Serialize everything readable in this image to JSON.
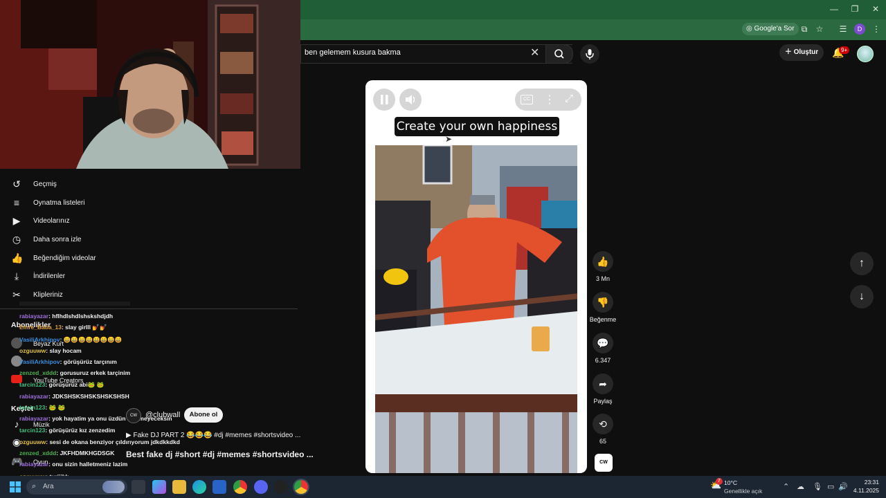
{
  "search": {
    "query": "ben gelemem kusura bakma"
  },
  "toolbar": {
    "google_sor": "Google'a Sor",
    "profile_letter": "D"
  },
  "header": {
    "create_label": "Oluştur",
    "notif_count": "9+"
  },
  "sidebar": {
    "items": [
      {
        "label": "Geçmiş",
        "icon": "history-icon"
      },
      {
        "label": "Oynatma listeleri",
        "icon": "playlist-icon"
      },
      {
        "label": "Videolarınız",
        "icon": "your-videos-icon"
      },
      {
        "label": "Daha sonra izle",
        "icon": "watch-later-icon"
      },
      {
        "label": "Beğendiğim videolar",
        "icon": "like-icon"
      },
      {
        "label": "İndirilenler",
        "icon": "download-icon"
      },
      {
        "label": "Klipleriniz",
        "icon": "scissors-icon"
      }
    ],
    "subscriptions_heading": "Abonelikler",
    "subscriptions": [
      "Beyaz Kurt",
      "YouTube Creators"
    ],
    "explore_heading": "Keşfet",
    "explore": [
      "Müzik",
      "Oyun"
    ]
  },
  "chat": [
    {
      "user": "Emre_Baba_13",
      "text": ": slay girlll 💅💅",
      "color": "#e0a030"
    },
    {
      "user": "rabiayazar",
      "text": ": hflhdlshdlshskshdjdh",
      "color": "#a070e0"
    },
    {
      "user": "VasiliArkhipov",
      "text": ": 😄😄😄😄😄😄😄😄",
      "color": "#3a8de0"
    },
    {
      "user": "ozguuww",
      "text": ": slay hocam",
      "color": "#e0c040"
    },
    {
      "user": "VasiliArkhipov",
      "text": ": görüşürüz tarçınım",
      "color": "#3a8de0"
    },
    {
      "user": "zenzed_xddd",
      "text": ": gorusuruz erkek tarçinim",
      "color": "#4caf50"
    },
    {
      "user": "tarcin123",
      "text": ": görüşürüz abi🐸 🐸",
      "color": "#40c080"
    },
    {
      "user": "rabiayazar",
      "text": ": JDKSHSKSHSKSHSKSHSH",
      "color": "#a070e0"
    },
    {
      "user": "tarcin123",
      "text": ": 🐸 🐸",
      "color": "#40c080"
    },
    {
      "user": "rabiayazar",
      "text": ": yok hayatim ya onu üzdün eklemeyeceksin",
      "color": "#a070e0"
    },
    {
      "user": "tarcin123",
      "text": ": görüşürüz kız zenzedim",
      "color": "#40c080"
    },
    {
      "user": "ozguuww",
      "text": ": sesi de okana benziyor çıldırıyorum jdkdkkdkd",
      "color": "#e0c040"
    },
    {
      "user": "zenzed_xddd",
      "text": ": JKFHDMKHGDSGK",
      "color": "#4caf50"
    },
    {
      "user": "rabiayazar",
      "text": ": onu sizin halletmeniz lazim",
      "color": "#a070e0"
    },
    {
      "user": "ozguuww",
      "text": ": turiiikk",
      "color": "#e0c040"
    }
  ],
  "short": {
    "caption": "Create your own happiness 😅",
    "channel": "@clubwall",
    "subscribe_label": "Abone ol",
    "music": "Fake DJ PART 2 😂😂😂 #dj #memes #shortsvideo ...",
    "title": "Best fake dj #short #dj #memes #shortsvideo ..."
  },
  "actions": {
    "likes": "3 Mn",
    "dislike_label": "Beğenme",
    "comments": "6.347",
    "share_label": "Paylaş",
    "remix_count": "65"
  },
  "taskbar": {
    "search_placeholder": "Ara",
    "weather_temp": "10°C",
    "weather_desc": "Genellikle açık",
    "time": "23:31",
    "date": "4.11.2025",
    "weather_badge": "7"
  }
}
